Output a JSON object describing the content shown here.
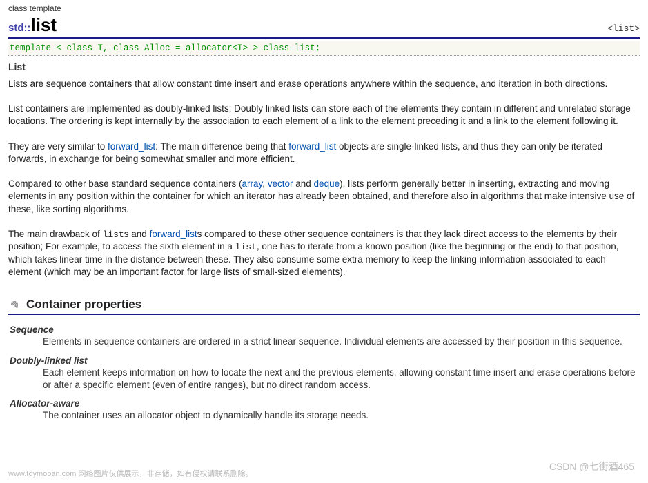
{
  "header": {
    "classTemplate": "class template",
    "prefix": "std::",
    "name": "list",
    "tag": "<list>"
  },
  "templateSig": "template < class T, class Alloc = allocator<T> > class list;",
  "sectionHeading": "List",
  "p1": "Lists are sequence containers that allow constant time insert and erase operations anywhere within the sequence, and iteration in both directions.",
  "p2": "List containers are implemented as doubly-linked lists; Doubly linked lists can store each of the elements they contain in different and unrelated storage locations. The ordering is kept internally by the association to each element of a link to the element preceding it and a link to the element following it.",
  "p3a": "They are very similar to ",
  "p3_link1": "forward_list",
  "p3b": ": The main difference being that ",
  "p3_link2": "forward_list",
  "p3c": " objects are single-linked lists, and thus they can only be iterated forwards, in exchange for being somewhat smaller and more efficient.",
  "p4a": "Compared to other base standard sequence containers (",
  "p4_link1": "array",
  "p4b": ", ",
  "p4_link2": "vector",
  "p4c": " and ",
  "p4_link3": "deque",
  "p4d": "), lists perform generally better in inserting, extracting and moving elements in any position within the container for which an iterator has already been obtained, and therefore also in algorithms that make intensive use of these, like sorting algorithms.",
  "p5a": "The main drawback of ",
  "p5_code1": "list",
  "p5b": "s and ",
  "p5_link1": "forward_list",
  "p5c": "s compared to these other sequence containers is that they lack direct access to the elements by their position; For example, to access the sixth element in a ",
  "p5_code2": "list",
  "p5d": ", one has to iterate from a known position (like the beginning or the end) to that position, which takes linear time in the distance between these. They also consume some extra memory to keep the linking information associated to each element (which may be an important factor for large lists of small-sized elements).",
  "containerProps": {
    "title": "Container properties",
    "items": [
      {
        "term": "Sequence",
        "desc": "Elements in sequence containers are ordered in a strict linear sequence. Individual elements are accessed by their position in this sequence."
      },
      {
        "term": "Doubly-linked list",
        "desc": "Each element keeps information on how to locate the next and the previous elements, allowing constant time insert and erase operations before or after a specific element (even of entire ranges), but no direct random access."
      },
      {
        "term": "Allocator-aware",
        "desc": "The container uses an allocator object to dynamically handle its storage needs."
      }
    ]
  },
  "watermarkLeft": "www.toymoban.com 网络图片仅供展示，非存储，如有侵权请联系删除。",
  "watermarkRight": "CSDN @七街酒465"
}
